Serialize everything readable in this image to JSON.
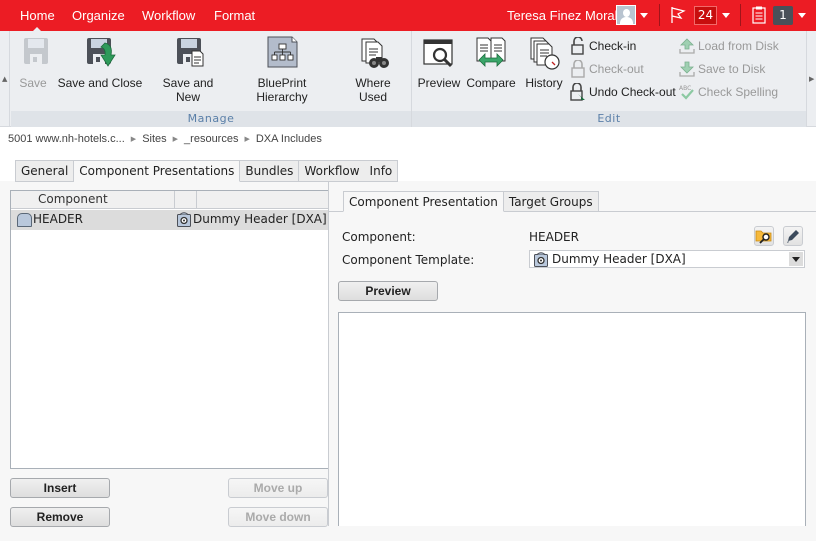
{
  "topbar": {
    "tabs": [
      {
        "label": "Home",
        "active": true
      },
      {
        "label": "Organize",
        "active": false
      },
      {
        "label": "Workflow",
        "active": false
      },
      {
        "label": "Format",
        "active": false
      }
    ],
    "user_name": "Teresa Finez Moral",
    "notifications_count": "24",
    "tasks_count": "1",
    "colors": {
      "brand": "#ec1c24",
      "notification_badge": "#c80e0e",
      "task_badge": "#4a5059"
    }
  },
  "ribbon": {
    "groups": [
      {
        "label": "Manage",
        "buttons": [
          {
            "label": "Save",
            "icon": "save-icon",
            "enabled": false
          },
          {
            "label": "Save and Close",
            "icon": "save-and-close-icon",
            "enabled": true
          },
          {
            "label": "Save and",
            "label2": "New",
            "icon": "save-and-new-icon",
            "enabled": true
          },
          {
            "label": "BluePrint Hierarchy",
            "icon": "blueprint-hierarchy-icon",
            "enabled": true
          },
          {
            "label": "Where Used",
            "icon": "where-used-icon",
            "enabled": true
          }
        ]
      },
      {
        "label": "Edit",
        "buttons": [
          {
            "label": "Preview",
            "icon": "preview-icon",
            "enabled": true
          },
          {
            "label": "Compare",
            "icon": "compare-icon",
            "enabled": true
          },
          {
            "label": "History",
            "icon": "history-icon",
            "enabled": true
          }
        ],
        "small_buttons": [
          {
            "label": "Check-in",
            "icon": "check-in-icon",
            "enabled": true
          },
          {
            "label": "Check-out",
            "icon": "check-out-icon",
            "enabled": false
          },
          {
            "label": "Undo Check-out",
            "icon": "undo-check-out-icon",
            "enabled": true
          },
          {
            "label": "Load from Disk",
            "icon": "load-from-disk-icon",
            "enabled": false
          },
          {
            "label": "Save to Disk",
            "icon": "save-to-disk-icon",
            "enabled": false
          },
          {
            "label": "Check Spelling",
            "icon": "check-spelling-icon",
            "enabled": false
          }
        ]
      }
    ]
  },
  "breadcrumb": [
    "5001 www.nh-hotels.c...",
    "Sites",
    "_resources",
    "DXA Includes"
  ],
  "main_tabs": [
    {
      "label": "General",
      "active": false
    },
    {
      "label": "Component Presentations",
      "active": true
    },
    {
      "label": "Bundles",
      "active": false
    },
    {
      "label": "Workflow",
      "active": false
    },
    {
      "label": "Info",
      "active": false
    }
  ],
  "presentations_list": {
    "columns": [
      "Component",
      "",
      ""
    ],
    "rows": [
      {
        "component": "HEADER",
        "template": "Dummy Header [DXA]",
        "selected": true
      }
    ]
  },
  "list_buttons": {
    "insert": "Insert",
    "remove": "Remove",
    "move_up": "Move up",
    "move_down": "Move down"
  },
  "detail": {
    "tabs": [
      {
        "label": "Component Presentation",
        "active": true
      },
      {
        "label": "Target Groups",
        "active": false
      }
    ],
    "component_label": "Component:",
    "component_value": "HEADER",
    "template_label": "Component Template:",
    "template_value": "Dummy Header [DXA]",
    "preview_button": "Preview"
  }
}
